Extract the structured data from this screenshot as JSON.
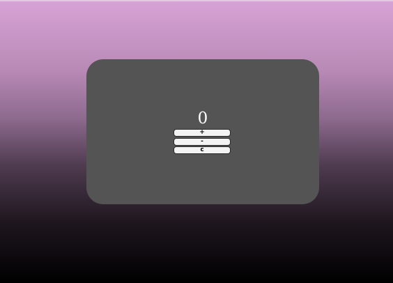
{
  "counter": {
    "value": "0"
  },
  "buttons": {
    "increment_label": "+",
    "decrement_label": "-",
    "clear_label": "c"
  },
  "colors": {
    "card_background": "#545454",
    "background_top": "#d7a3d6",
    "background_bottom": "#000000",
    "button_background": "#f3f3f3",
    "counter_text": "#ffffff"
  }
}
